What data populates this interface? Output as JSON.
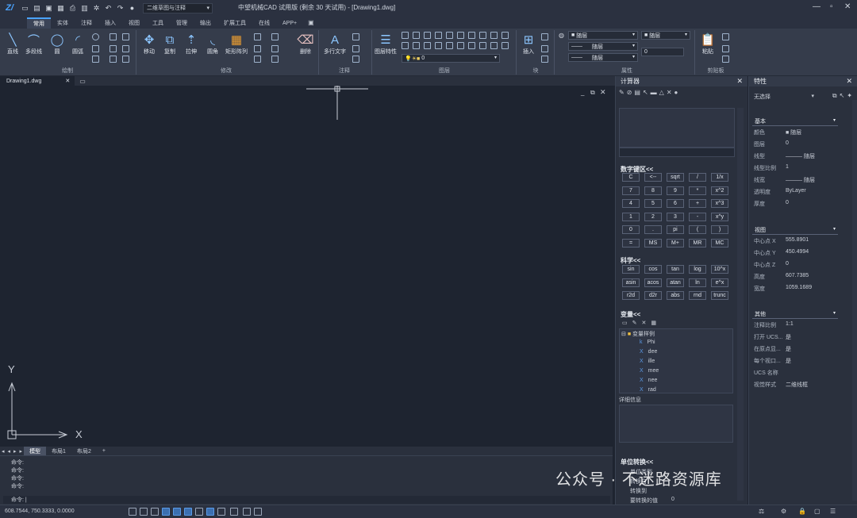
{
  "titlebar": {
    "workspace": "二维草图与注释",
    "title": "中望机械CAD 试用版 (剩余 30 天试用) - [Drawing1.dwg]"
  },
  "tabs": [
    "常用",
    "实体",
    "注释",
    "插入",
    "视图",
    "工具",
    "管理",
    "输出",
    "扩展工具",
    "在线",
    "APP+"
  ],
  "ribbon": {
    "draw": {
      "line": "直线",
      "polyline": "多段线",
      "circle": "圆",
      "arc": "圆弧",
      "group": "绘制"
    },
    "modify": {
      "move": "移动",
      "copy": "复制",
      "stretch": "拉伸",
      "fillet": "圆角",
      "array": "矩形阵列",
      "erase": "删除",
      "group": "修改"
    },
    "annotation": {
      "mtext": "多行文字",
      "group": "注释"
    },
    "layers": {
      "layer_props": "图层特性",
      "current_layer": "0",
      "group": "图层"
    },
    "block": {
      "insert": "插入",
      "group": "块"
    },
    "properties": {
      "color": "随层",
      "linetype": "随层",
      "lineweight": "随层",
      "plotstyle": "随层",
      "value": "0",
      "group": "属性"
    },
    "clipboard": {
      "paste": "粘贴",
      "group": "剪贴板"
    }
  },
  "doc_tab": "Drawing1.dwg",
  "canvas": {
    "ucs_x": "X",
    "ucs_y": "Y"
  },
  "layouts": [
    "模型",
    "布局1",
    "布局2",
    "+"
  ],
  "command": {
    "lines": [
      "命令:",
      "命令:",
      "命令:",
      "命令:"
    ],
    "prompt": "命令:"
  },
  "status": {
    "coords": "608.7544, 750.3333, 0.0000"
  },
  "calculator": {
    "title": "计算器",
    "numpad_title": "数字键区<<",
    "numpad": [
      [
        "C",
        "<--",
        "sqrt",
        "/",
        "1/x"
      ],
      [
        "7",
        "8",
        "9",
        "*",
        "x^2"
      ],
      [
        "4",
        "5",
        "6",
        "+",
        "x^3"
      ],
      [
        "1",
        "2",
        "3",
        "-",
        "x^y"
      ],
      [
        "0",
        ".",
        "pi",
        "(",
        ")"
      ],
      [
        "=",
        "MS",
        "M+",
        "MR",
        "MC"
      ]
    ],
    "sci_title": "科学<<",
    "sci": [
      [
        "sin",
        "cos",
        "tan",
        "log",
        "10^x"
      ],
      [
        "asin",
        "acos",
        "atan",
        "ln",
        "e^x"
      ],
      [
        "r2d",
        "d2r",
        "abs",
        "rnd",
        "trunc"
      ]
    ],
    "vars_title": "变量<<",
    "var_group": "变量样例",
    "vars": [
      "Phi",
      "dee",
      "ille",
      "mee",
      "nee",
      "rad"
    ],
    "details_title": "详细信息",
    "units_title": "单位转换<<",
    "units": [
      "单位类型",
      "转换自",
      "转换到",
      "要转换的值"
    ],
    "unit_value": "0"
  },
  "properties": {
    "title": "特性",
    "selection": "无选择",
    "basic_title": "基本",
    "basic": [
      {
        "k": "颜色",
        "v": "■ 随层"
      },
      {
        "k": "图层",
        "v": "0"
      },
      {
        "k": "线型",
        "v": "——— 随层"
      },
      {
        "k": "线型比例",
        "v": "1"
      },
      {
        "k": "线宽",
        "v": "——— 随层"
      },
      {
        "k": "透明度",
        "v": "ByLayer"
      },
      {
        "k": "厚度",
        "v": "0"
      }
    ],
    "view_title": "视图",
    "view": [
      {
        "k": "中心点 X",
        "v": "555.8901"
      },
      {
        "k": "中心点 Y",
        "v": "450.4994"
      },
      {
        "k": "中心点 Z",
        "v": "0"
      },
      {
        "k": "高度",
        "v": "607.7385"
      },
      {
        "k": "宽度",
        "v": "1059.1689"
      }
    ],
    "misc_title": "其他",
    "misc": [
      {
        "k": "注释比例",
        "v": "1:1"
      },
      {
        "k": "打开 UCS...",
        "v": "是"
      },
      {
        "k": "在原点显...",
        "v": "是"
      },
      {
        "k": "每个视口...",
        "v": "是"
      },
      {
        "k": "UCS 名称",
        "v": ""
      },
      {
        "k": "视觉样式",
        "v": "二维线框"
      }
    ]
  },
  "watermark": "公众号 · 不迷路资源库"
}
